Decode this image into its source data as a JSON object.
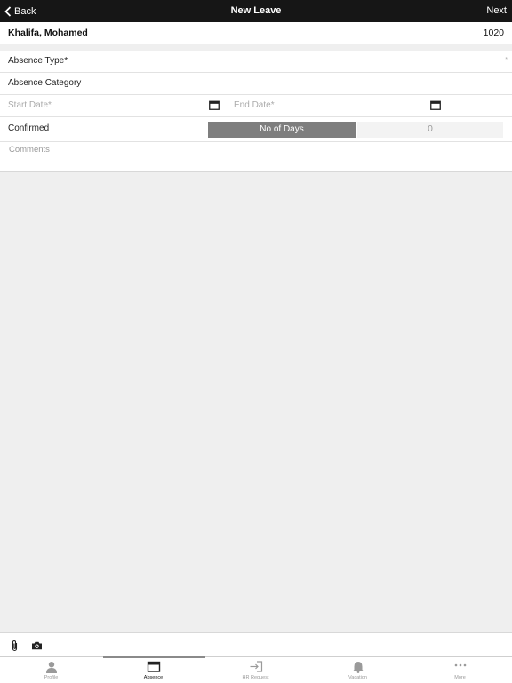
{
  "navbar": {
    "back_label": "Back",
    "title": "New Leave",
    "next_label": "Next"
  },
  "employee": {
    "name": "Khalifa, Mohamed",
    "id": "1020"
  },
  "form": {
    "absence_type_label": "Absence Type*",
    "absence_type_required_mark": "*",
    "absence_category_label": "Absence Category",
    "start_date_placeholder": "Start Date*",
    "end_date_placeholder": "End Date*",
    "confirmed_label": "Confirmed",
    "no_of_days_label": "No of Days",
    "no_of_days_value": "0",
    "comments_placeholder": "Comments"
  },
  "attachments": {
    "icons": [
      "paperclip-icon",
      "camera-icon"
    ]
  },
  "tabbar": {
    "active": "absence",
    "tabs": [
      {
        "label": "Profile",
        "icon": "person-icon"
      },
      {
        "label": "Absence",
        "icon": "calendar-icon"
      },
      {
        "label": "HR Request",
        "icon": "sign-in-icon"
      },
      {
        "label": "Vacation",
        "icon": "bell-icon"
      },
      {
        "label": "More",
        "icon": "ellipsis-icon"
      }
    ]
  },
  "colors": {
    "navbar_bg": "#161616",
    "days_label_bg": "#7e7e7e",
    "page_bg": "#efefef"
  }
}
